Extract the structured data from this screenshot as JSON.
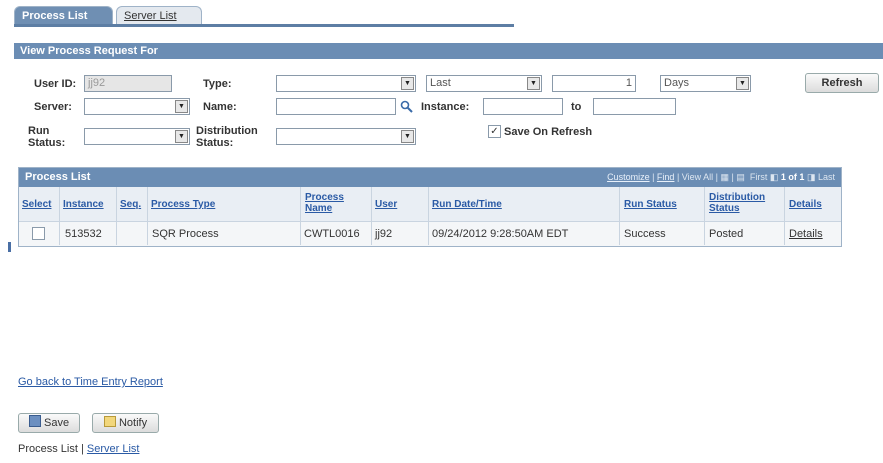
{
  "tabs": [
    {
      "label": "Process List",
      "active": true
    },
    {
      "label": "Server List",
      "active": false
    }
  ],
  "filter": {
    "title": "View Process Request For",
    "user_id_label": "User ID:",
    "user_id_value": "jj92",
    "type_label": "Type:",
    "type_value": "",
    "last_value": "Last",
    "count_value": "1",
    "unit_value": "Days",
    "refresh_label": "Refresh",
    "server_label": "Server:",
    "server_value": "",
    "name_label": "Name:",
    "name_value": "",
    "instance_label": "Instance:",
    "instance_from": "",
    "to_label": "to",
    "instance_to": "",
    "run_label_1": "Run",
    "run_label_2": "Status:",
    "run_value": "",
    "dist_label_1": "Distribution",
    "dist_label_2": "Status:",
    "dist_value": "",
    "save_on_refresh_label": "Save On Refresh",
    "save_on_refresh_checked": true
  },
  "process_list": {
    "title": "Process List",
    "tools": {
      "customize": "Customize",
      "find": "Find",
      "view_all": "View All",
      "first": "First",
      "range": "1 of 1",
      "last": "Last"
    },
    "columns": {
      "select": "Select",
      "instance": "Instance",
      "seq": "Seq.",
      "process_type": "Process Type",
      "process_name_1": "Process",
      "process_name_2": "Name",
      "user": "User",
      "run_datetime": "Run Date/Time",
      "run_status": "Run Status",
      "dist_status_1": "Distribution",
      "dist_status_2": "Status",
      "details": "Details"
    },
    "rows": [
      {
        "instance": "513532",
        "seq": "",
        "process_type": "SQR Process",
        "process_name": "CWTL0016",
        "user": "jj92",
        "run_datetime": "09/24/2012  9:28:50AM EDT",
        "run_status": "Success",
        "dist_status": "Posted",
        "details": "Details"
      }
    ]
  },
  "footer": {
    "back_link": "Go back to Time Entry Report",
    "save_label": "Save",
    "notify_label": "Notify",
    "bottom_link_1": "Process List",
    "separator": "|",
    "bottom_link_2": "Server List"
  },
  "colors": {
    "header_bar": "#6b8db4",
    "link": "#2a5aa5",
    "tab_active": "#6f8fb3"
  }
}
